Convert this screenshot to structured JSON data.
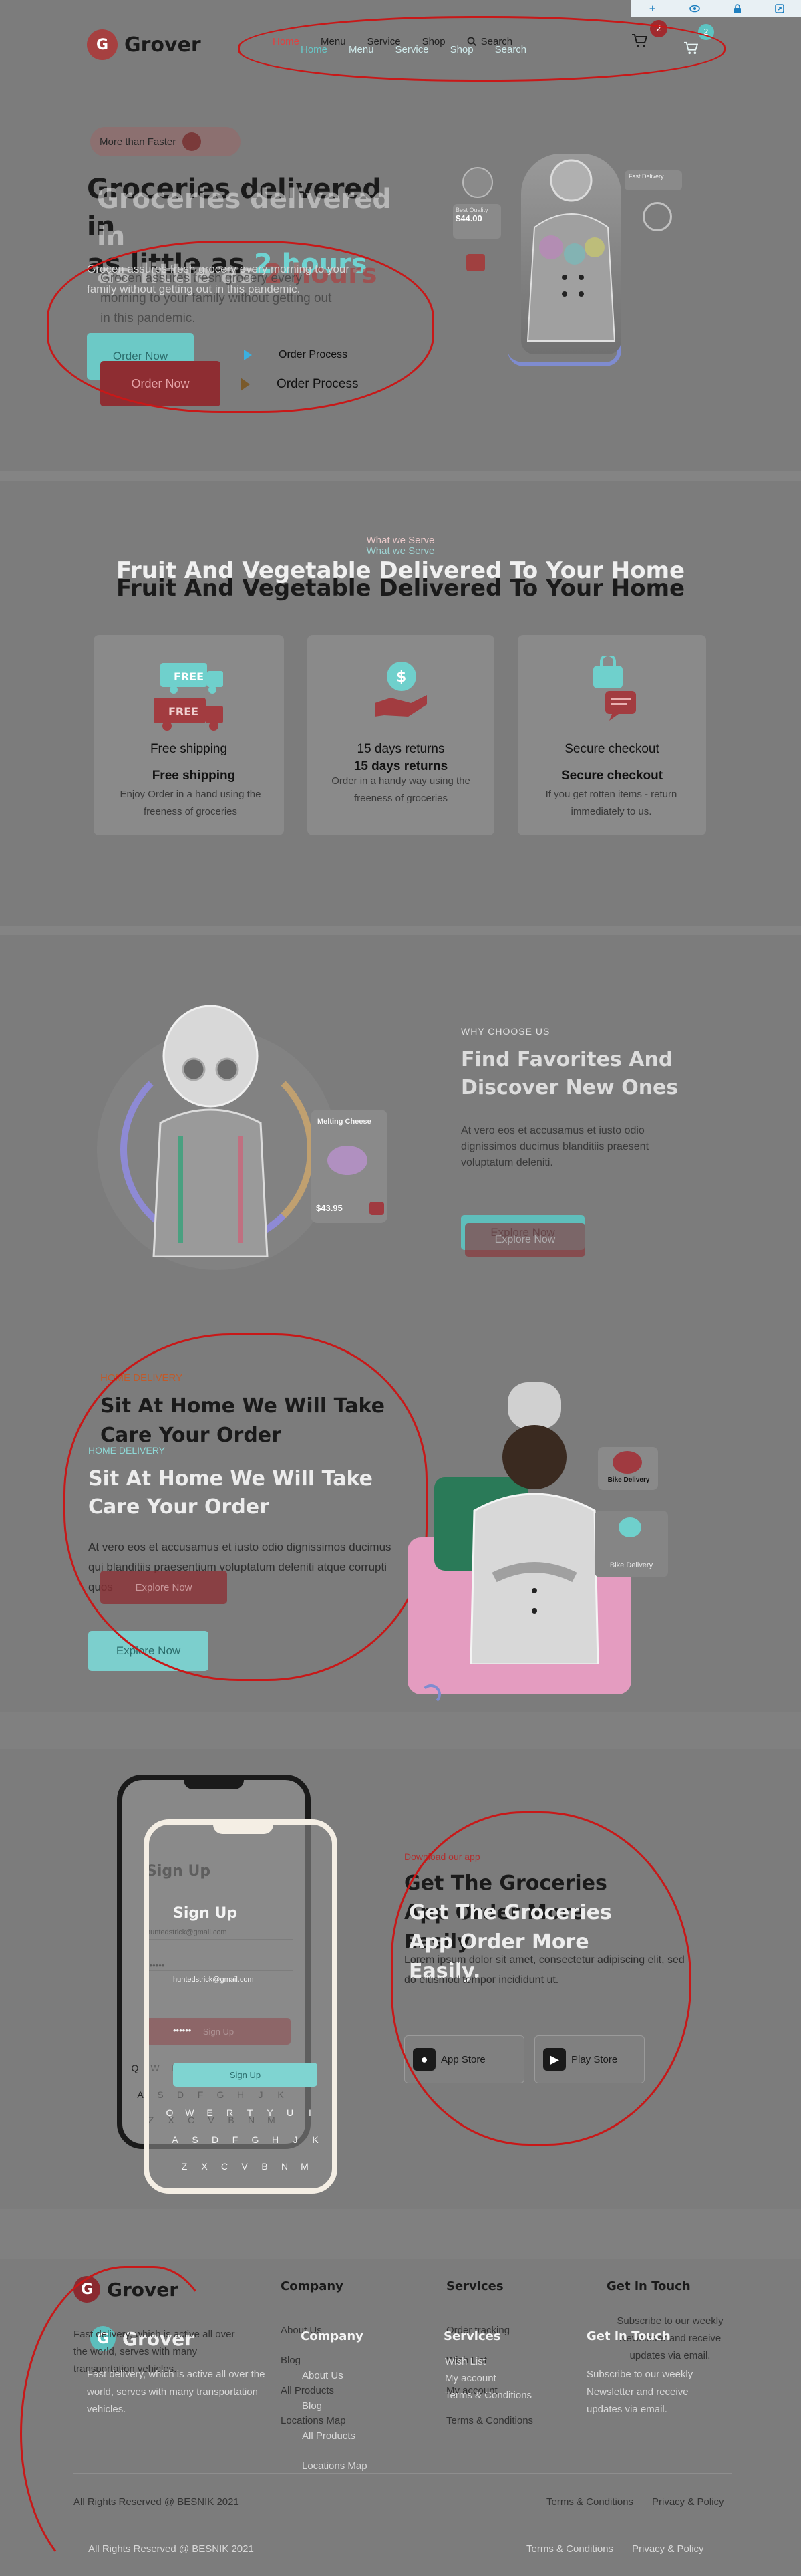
{
  "toolbar": {
    "icons": [
      "plus-icon",
      "eye-icon",
      "lock-icon",
      "share-icon"
    ]
  },
  "brand": {
    "name": "Grover",
    "mark": "G"
  },
  "nav": {
    "links": [
      "Home",
      "Menu",
      "Service",
      "Shop"
    ],
    "search": "Search",
    "cart_count": "2",
    "cart_count_ghost": "2"
  },
  "hero": {
    "badge": "More than Faster",
    "title_line1": "Groceries delivered in",
    "title_line2_prefix": "as little as ",
    "title_highlight": "2 hours",
    "paragraph": "Grocen assures fresh grocery every morning to your family without getting out in this pandemic.",
    "paragraph_ghost": "Grocen assures fresh grocery every morning to your family without getting out in this pandemic.",
    "cta_order": "Order Now",
    "cta_process": "Order Process",
    "card_price": "$44.00",
    "card_label": "Best Quality",
    "delivery_tag": "Fast Delivery"
  },
  "serve": {
    "kicker": "What we Serve",
    "title": "Fruit And Vegetable Delivered To Your Home",
    "cards": [
      {
        "title": "Free shipping",
        "text": "Enjoy Order in a hand using the freeness of groceries",
        "badge": "FREE"
      },
      {
        "title": "15 days returns",
        "text": "Order in a handy way using the freeness of groceries",
        "badge": "$"
      },
      {
        "title": "Secure checkout",
        "text": "If you get rotten items - return immediately to us.",
        "badge": "lock"
      }
    ]
  },
  "why": {
    "kicker": "WHY CHOOSE US",
    "title": "Find Favorites And Discover New Ones",
    "paragraph": "At vero eos et accusamus et iusto odio dignissimos ducimus blanditiis praesent voluptatum deleniti.",
    "cta": "Explore Now",
    "product_name": "Melting Cheese",
    "product_price": "$43.95"
  },
  "home_delivery": {
    "kicker": "HOME DELIVERY",
    "title": "Sit At Home We Will Take Care Your Order",
    "paragraph": "At vero eos et accusamus et iusto odio dignissimos ducimus qui blanditiis praesentium voluptatum deleniti atque corrupti quos",
    "cta": "Explore Now",
    "badge_label": "Bike Delivery"
  },
  "app": {
    "kicker": "Download our app",
    "title": "Get The Groceries App Order More Easily.",
    "paragraph": "Lorem ipsum dolor sit amet, consectetur adipiscing elit, sed do eiusmod tempor incididunt ut.",
    "app_store": "App Store",
    "play_store": "Play Store",
    "phone": {
      "title": "Sign Up",
      "email": "huntedstrick@gmail.com",
      "password": "••••••",
      "button": "Sign Up",
      "row1": [
        "Q",
        "W",
        "E",
        "R",
        "T",
        "Y",
        "U",
        "I",
        "O",
        "P"
      ],
      "row2": [
        "A",
        "S",
        "D",
        "F",
        "G",
        "H",
        "J",
        "K",
        "L"
      ],
      "row3": [
        "Z",
        "X",
        "C",
        "V",
        "B",
        "N",
        "M"
      ]
    }
  },
  "footer": {
    "about": "Fast delivery, which is active all over the world, serves with many transportation vehicles.",
    "columns": [
      {
        "title": "Company",
        "links": [
          "About Us",
          "Blog",
          "All Products",
          "Locations Map"
        ]
      },
      {
        "title": "Services",
        "links": [
          "Order tracking",
          "Wish List",
          "My account",
          "Terms & Conditions"
        ]
      },
      {
        "title": "Get in Touch",
        "links": [
          "Subscribe to our weekly Newsletter and receive updates via email."
        ]
      }
    ],
    "copyright": "All Rights Reserved @ BESNIK 2021",
    "terms": "Terms & Conditions",
    "privacy": "Privacy & Policy"
  }
}
